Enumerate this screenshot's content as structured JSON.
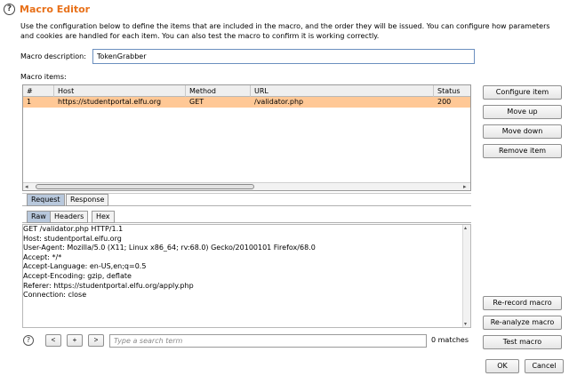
{
  "window": {
    "title": "Macro Editor",
    "help_glyph": "?",
    "description": "Use the configuration below to define the items that are included in the macro, and the order they will be issued. You can configure how parameters and cookies are handled for each item. You can also test the macro to confirm it is working correctly."
  },
  "form": {
    "macro_description_label": "Macro description:",
    "macro_description_value": "TokenGrabber",
    "macro_items_label": "Macro items:"
  },
  "table": {
    "columns": [
      "#",
      "Host",
      "Method",
      "URL",
      "Status"
    ],
    "rows": [
      {
        "num": "1",
        "host": "https://studentportal.elfu.org",
        "method": "GET",
        "url": "/validator.php",
        "status": "200"
      }
    ],
    "selected_row_color": "#ffc896"
  },
  "side_buttons": {
    "configure_item": "Configure item",
    "move_up": "Move up",
    "move_down": "Move down",
    "remove_item": "Remove item",
    "re_record_macro": "Re-record macro",
    "re_analyze_macro": "Re-analyze macro",
    "test_macro": "Test macro"
  },
  "tabs": {
    "top": [
      {
        "label": "Request",
        "active": true
      },
      {
        "label": "Response",
        "active": false
      }
    ],
    "view": [
      {
        "label": "Raw",
        "active": true
      },
      {
        "label": "Headers",
        "active": false
      },
      {
        "label": "Hex",
        "active": false
      }
    ]
  },
  "request": {
    "raw": "GET /validator.php HTTP/1.1\nHost: studentportal.elfu.org\nUser-Agent: Mozilla/5.0 (X11; Linux x86_64; rv:68.0) Gecko/20100101 Firefox/68.0\nAccept: */*\nAccept-Language: en-US,en;q=0.5\nAccept-Encoding: gzip, deflate\nReferer: https://studentportal.elfu.org/apply.php\nConnection: close"
  },
  "search": {
    "help_glyph": "?",
    "prev_label": "<",
    "add_label": "+",
    "next_label": ">",
    "placeholder": "Type a search term",
    "matches": "0 matches"
  },
  "dialog": {
    "ok": "OK",
    "cancel": "Cancel"
  },
  "colors": {
    "title": "#e8711a",
    "active_tab": "#b8c8dc",
    "input_border": "#6b8fbf"
  },
  "icons": {
    "scroll_left": "◂",
    "scroll_right": "▸",
    "scroll_up": "▴",
    "scroll_down": "▾"
  }
}
